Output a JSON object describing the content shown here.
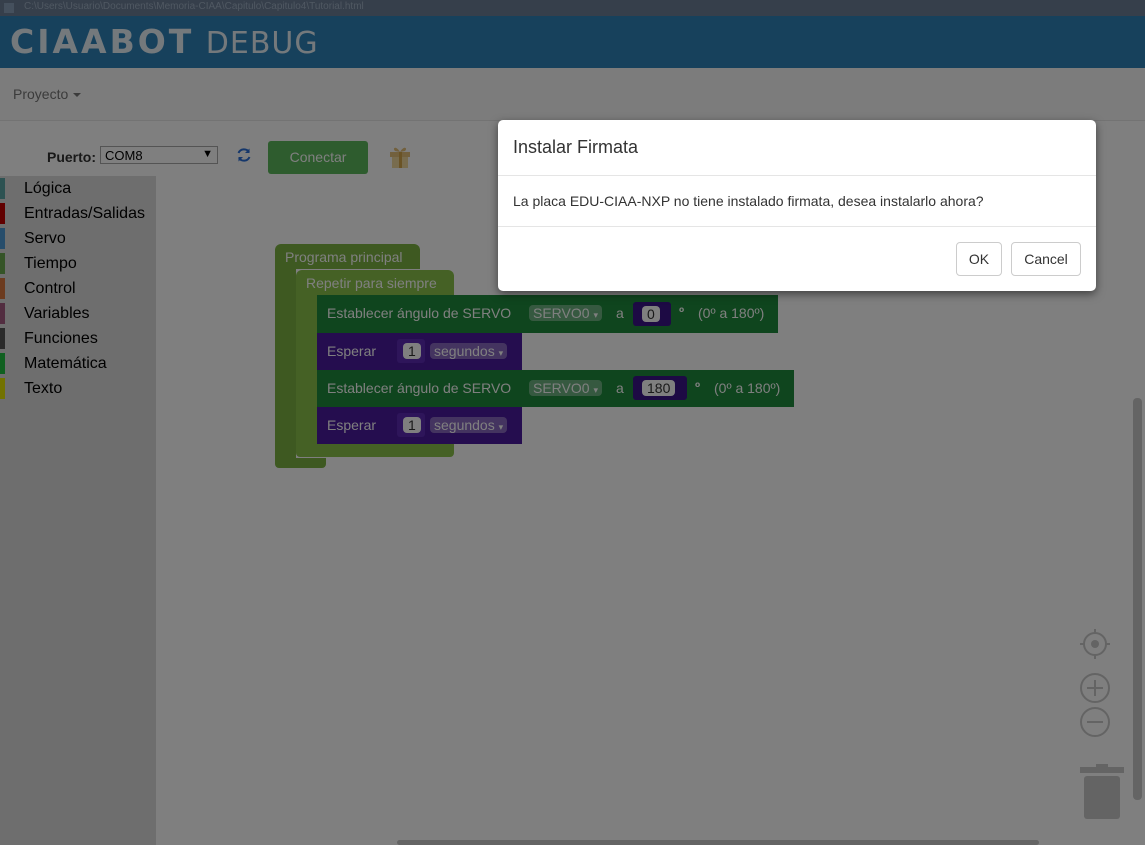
{
  "window": {
    "title": "C:\\Users\\Usuario\\Documents\\Memoria-CIAA\\Capitulo\\Capitulo4\\Tutorial.html"
  },
  "app": {
    "logo_main": "CIAABOT",
    "logo_sub": "DEBUG"
  },
  "menu": {
    "project_label": "Proyecto"
  },
  "toolbar": {
    "port_label": "Puerto:",
    "port_value": "COM8",
    "connect_label": "Conectar"
  },
  "toolbox": {
    "categories": [
      {
        "label": "Lógica",
        "color": "#5ba5a5"
      },
      {
        "label": "Entradas/Salidas",
        "color": "#c30000"
      },
      {
        "label": "Servo",
        "color": "#4f9bd6"
      },
      {
        "label": "Tiempo",
        "color": "#6aa84f"
      },
      {
        "label": "Control",
        "color": "#d9763e"
      },
      {
        "label": "Variables",
        "color": "#a55b80"
      },
      {
        "label": "Funciones",
        "color": "#555555"
      },
      {
        "label": "Matemática",
        "color": "#20c040"
      },
      {
        "label": "Texto",
        "color": "#e5e500"
      }
    ]
  },
  "blocks": {
    "main_label": "Programa principal",
    "loop_label": "Repetir para siempre",
    "servo1": {
      "label": "Establecer ángulo de SERVO",
      "servo": "SERVO0",
      "a": "a",
      "angle": "0",
      "deg": "º",
      "range": "(0º a 180º)"
    },
    "wait1": {
      "label": "Esperar",
      "value": "1",
      "unit": "segundos"
    },
    "servo2": {
      "label": "Establecer ángulo de SERVO",
      "servo": "SERVO0",
      "a": "a",
      "angle": "180",
      "deg": "º",
      "range": "(0º a 180º)"
    },
    "wait2": {
      "label": "Esperar",
      "value": "1",
      "unit": "segundos"
    }
  },
  "modal": {
    "title": "Instalar Firmata",
    "body": "La placa EDU-CIAA-NXP no tiene instalado firmata, desea instalarlo ahora?",
    "ok_label": "OK",
    "cancel_label": "Cancel"
  },
  "colors": {
    "header": "#2e82b9",
    "connect": "#5cb85c",
    "block_main": "#7cb342",
    "block_servo": "#1e8a3c",
    "block_wait": "#4a1a9e"
  }
}
